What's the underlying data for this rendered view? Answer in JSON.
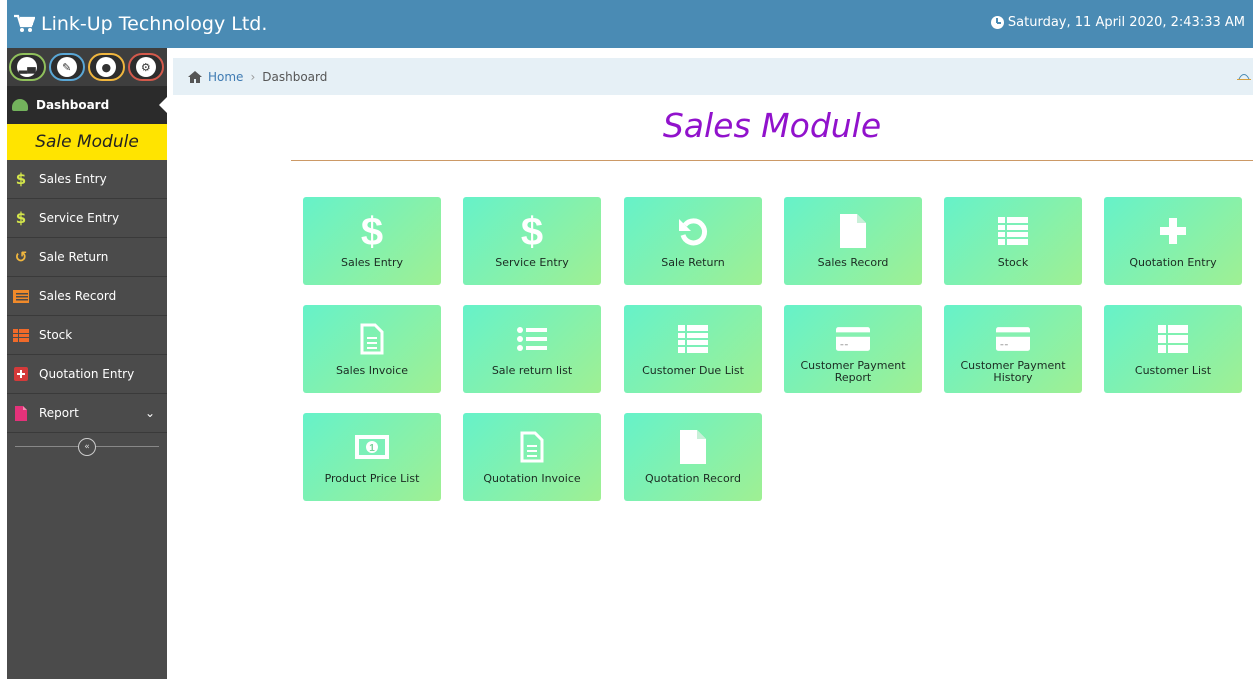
{
  "header": {
    "brand": "Link-Up Technology Ltd.",
    "datetime": "Saturday, 11 April 2020, 2:43:33 AM"
  },
  "sidebar": {
    "dashboard_label": "Dashboard",
    "module_label": "Sale Module",
    "items": [
      {
        "label": "Sales Entry",
        "icon": "dollar-icon",
        "color": "#d4e64a"
      },
      {
        "label": "Service Entry",
        "icon": "dollar-icon",
        "color": "#d4e64a"
      },
      {
        "label": "Sale Return",
        "icon": "undo-icon",
        "color": "#f0b63e"
      },
      {
        "label": "Sales Record",
        "icon": "list-icon",
        "color": "#f08a2a"
      },
      {
        "label": "Stock",
        "icon": "table-icon",
        "color": "#f06a2a"
      },
      {
        "label": "Quotation Entry",
        "icon": "plus-square-icon",
        "color": "#d43a3a"
      },
      {
        "label": "Report",
        "icon": "file-icon",
        "color": "#e4327a"
      }
    ]
  },
  "breadcrumb": {
    "home": "Home",
    "current": "Dashboard"
  },
  "main": {
    "title": "Sales Module",
    "tiles": [
      {
        "label": "Sales Entry",
        "icon": "dollar-icon"
      },
      {
        "label": "Service Entry",
        "icon": "dollar-icon"
      },
      {
        "label": "Sale Return",
        "icon": "undo-icon"
      },
      {
        "label": "Sales Record",
        "icon": "file-icon"
      },
      {
        "label": "Stock",
        "icon": "list-icon"
      },
      {
        "label": "Quotation Entry",
        "icon": "plus-icon"
      },
      {
        "label": "Sales Invoice",
        "icon": "document-icon"
      },
      {
        "label": "Sale return list",
        "icon": "bullet-list-icon"
      },
      {
        "label": "Customer Due List",
        "icon": "list-icon"
      },
      {
        "label": "Customer Payment Report",
        "icon": "credit-card-icon"
      },
      {
        "label": "Customer Payment History",
        "icon": "credit-card-icon"
      },
      {
        "label": "Customer List",
        "icon": "th-list-icon"
      },
      {
        "label": "Product Price List",
        "icon": "money-icon"
      },
      {
        "label": "Quotation Invoice",
        "icon": "document-icon"
      },
      {
        "label": "Quotation Record",
        "icon": "file-icon"
      }
    ]
  },
  "colors": {
    "header": "#4a8bb4",
    "sidebar": "#4b4b4b",
    "module_highlight": "#ffe400",
    "title": "#9112cc",
    "tile_start": "#66f2c9",
    "tile_end": "#9ff093"
  }
}
